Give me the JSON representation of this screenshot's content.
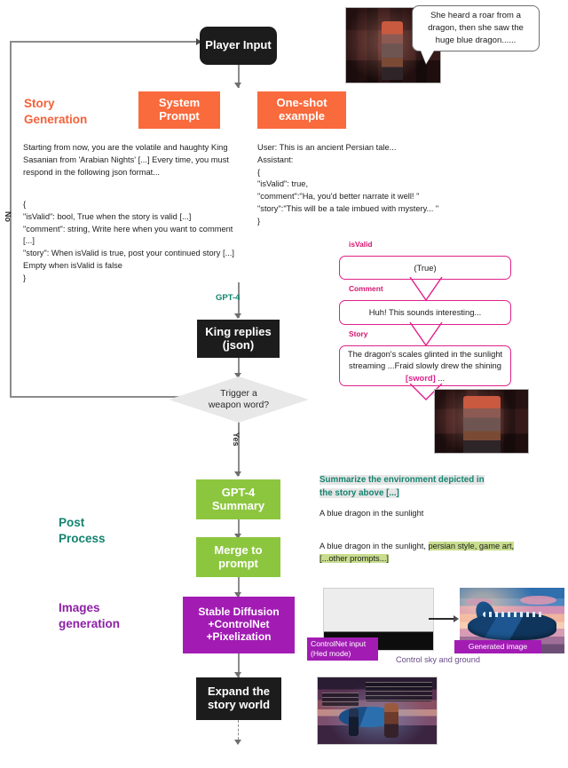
{
  "sections": {
    "story_generation": "Story\nGeneration",
    "post_process": "Post\nProcess",
    "images_generation": "Images\ngeneration"
  },
  "nodes": {
    "player_input": "Player Input",
    "system_prompt": "System\nPrompt",
    "one_shot": "One-shot\nexample",
    "king_replies": "King replies\n(json)",
    "decision": "Trigger a\nweapon word?",
    "gpt4_summary": "GPT-4\nSummary",
    "merge_to_prompt": "Merge to\nprompt",
    "stable_diffusion": "Stable Diffusion\n+ControlNet\n+Pixelization",
    "expand_story": "Expand the\nstory world"
  },
  "edge_labels": {
    "no": "No",
    "yes": "Yes",
    "gpt4": "GPT-4"
  },
  "prompts": {
    "system_prompt_body": "Starting from now, you are the volatile and haughty King Sasanian from 'Arabian Nights' [...] Every time, you must respond in the following json format...",
    "system_prompt_json": "{\n\"isValid\": bool, True when the story is valid [...]\n\"comment\": string, Write here when you want to comment [...]\n\"story\": When isValid is true, post your continued story [...] Empty when isValid is false\n}",
    "one_shot_body": "User: This is an ancient Persian tale...\nAssistant:\n{\n\"isValid\": true,\n\"comment\":\"Ha, you'd better narrate it well! \"\n\"story\":\"This will be a tale imbued with mystery... \"\n}"
  },
  "speech_bubble": {
    "text": "She heard a roar from a dragon, then she saw the huge blue dragon......"
  },
  "json_fields": {
    "isvalid_label": "isValid",
    "isvalid_value": "(True)",
    "comment_label": "Comment",
    "comment_value": "Huh! This sounds interesting...",
    "story_label": "Story",
    "story_value_pre": "The dragon's scales glinted in the sunlight streaming ...Fraid slowly drew the shining ",
    "story_value_keyword": "[sword]",
    "story_value_post": " ..."
  },
  "post_process_texts": {
    "summary_instruction": "Summarize the environment depicted in the story above [...]",
    "summary_output": "A blue dragon in the sunlight",
    "merged_prompt_pre": "A blue dragon in the sunlight, ",
    "merged_prompt_highlight": "persian style, game art, [...other prompts...]"
  },
  "image_labels": {
    "controlnet_input": "ControlNet input\n(Hed mode)",
    "generated_image": "Generated image",
    "control_caption": "Control sky and ground"
  },
  "colors": {
    "orange": "#f96a3c",
    "green": "#8cc63f",
    "purple": "#a21cb4",
    "teal": "#13836f",
    "pink": "#e0218a",
    "black": "#1c1c1c",
    "diamond_gray": "#e8e8e8"
  }
}
